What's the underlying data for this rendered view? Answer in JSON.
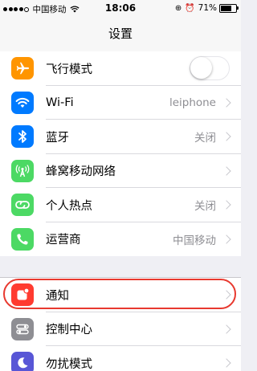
{
  "status_bar": {
    "carrier": "中国移动",
    "time": "18:06",
    "battery": "71%",
    "battery_level": 0.71
  },
  "nav": {
    "title": "设置"
  },
  "colors": {
    "orange": "#ff9500",
    "blue": "#007aff",
    "green": "#4cd964",
    "red": "#ff3b30",
    "gray": "#8e8e93",
    "purple": "#5856d6",
    "highlight": "#e8392f"
  },
  "rows": [
    {
      "label": "飞行模式",
      "icon": "airplane-icon",
      "toggle": false
    },
    {
      "label": "Wi-Fi",
      "icon": "wifi-icon",
      "value": "leiphone"
    },
    {
      "label": "蓝牙",
      "icon": "bluetooth-icon",
      "value": "关闭"
    },
    {
      "label": "蜂窝移动网络",
      "icon": "cellular-antenna-icon"
    },
    {
      "label": "个人热点",
      "icon": "hotspot-chain-icon",
      "value": "关闭"
    },
    {
      "label": "运营商",
      "icon": "phone-icon",
      "value": "中国移动"
    }
  ],
  "rows2": [
    {
      "label": "通知",
      "icon": "notifications-icon"
    },
    {
      "label": "控制中心",
      "icon": "control-center-icon"
    },
    {
      "label": "勿扰模式",
      "icon": "moon-icon"
    }
  ]
}
